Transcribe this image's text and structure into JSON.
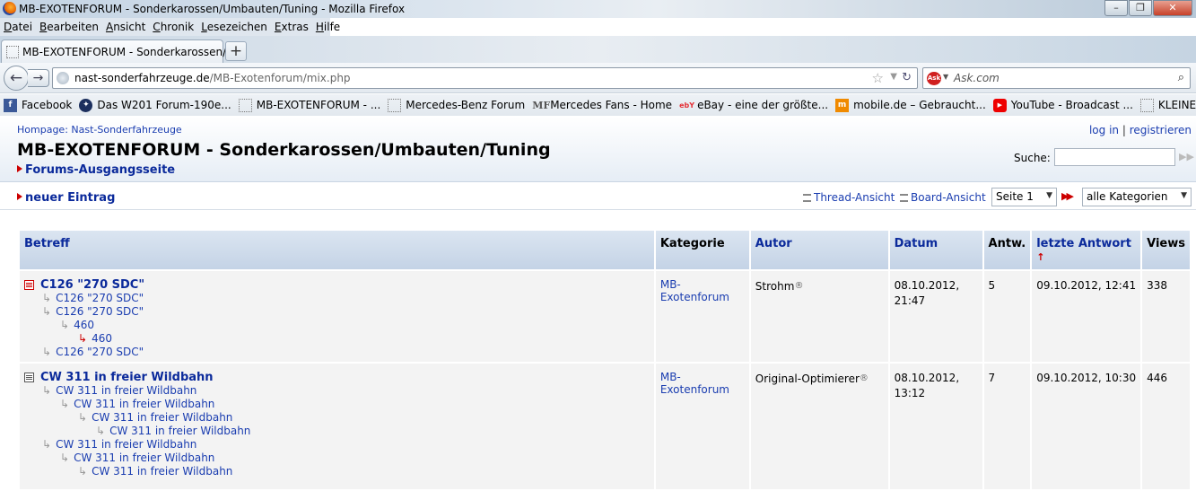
{
  "window": {
    "title": "MB-EXOTENFORUM - Sonderkarossen/Umbauten/Tuning - Mozilla Firefox",
    "buttons": [
      "–",
      "❐",
      "✕"
    ]
  },
  "menu": [
    "Datei",
    "Bearbeiten",
    "Ansicht",
    "Chronik",
    "Lesezeichen",
    "Extras",
    "Hilfe"
  ],
  "tab": {
    "title": "MB-EXOTENFORUM - Sonderkarossen/...",
    "new_tab": "+"
  },
  "url": {
    "domain": "nast-sonderfahrzeuge.de",
    "path": "/MB-Exotenforum/mix.php"
  },
  "search": {
    "placeholder": "Ask.com",
    "engine": "Ask"
  },
  "bookmarks": [
    {
      "label": "Facebook",
      "icon": "facebook-icon"
    },
    {
      "label": "Das W201 Forum-190e...",
      "icon": "mercedes-icon"
    },
    {
      "label": "MB-EXOTENFORUM - ...",
      "icon": "page-icon"
    },
    {
      "label": "Mercedes-Benz Forum",
      "icon": "page-icon"
    },
    {
      "label": "Mercedes Fans - Home",
      "icon": "mf-icon"
    },
    {
      "label": "eBay - eine der größte...",
      "icon": "ebay-icon"
    },
    {
      "label": "mobile.de – Gebraucht...",
      "icon": "mobile-icon"
    },
    {
      "label": "YouTube - Broadcast ...",
      "icon": "youtube-icon"
    },
    {
      "label": "KLEINENBROICH Wett...",
      "icon": "page-icon"
    }
  ],
  "header": {
    "homepage": "Hompage: Nast-Sonderfahrzeuge",
    "title": "MB-EXOTENFORUM - Sonderkarossen/Umbauten/Tuning",
    "exit_link": "Forums-Ausgangsseite",
    "login": "log in",
    "separator": "|",
    "register": "registrieren",
    "search_label": "Suche:"
  },
  "toolbar": {
    "new_entry": "neuer Eintrag",
    "thread_view": "Thread-Ansicht",
    "board_view": "Board-Ansicht",
    "page_select": "Seite 1",
    "category_select": "alle Kategorien"
  },
  "table": {
    "headers": {
      "subject": "Betreff",
      "category": "Kategorie",
      "author": "Autor",
      "date": "Datum",
      "replies": "Antw.",
      "last_reply": "letzte Antwort",
      "views": "Views"
    },
    "sort_indicator": "↑",
    "threads": [
      {
        "subject": "C126 \"270 SDC\"",
        "category": "MB-Exotenforum",
        "author": "Strohm",
        "date": "08.10.2012,",
        "time": "21:47",
        "replies": "5",
        "last_reply": "09.10.2012, 12:41",
        "views": "338",
        "children": [
          {
            "label": "C126 \"270 SDC\"",
            "level": 1
          },
          {
            "label": "C126 \"270 SDC\"",
            "level": 1
          },
          {
            "label": "460",
            "level": 2
          },
          {
            "label": "460",
            "level": 3,
            "new": true
          },
          {
            "label": "C126 \"270 SDC\"",
            "level": 1
          }
        ]
      },
      {
        "subject": "CW 311 in freier Wildbahn",
        "category": "MB-Exotenforum",
        "author": "Original-Optimierer",
        "date": "08.10.2012,",
        "time": "13:12",
        "replies": "7",
        "last_reply": "09.10.2012, 10:30",
        "views": "446",
        "children": [
          {
            "label": "CW 311 in freier Wildbahn",
            "level": 1
          },
          {
            "label": "CW 311 in freier Wildbahn",
            "level": 2
          },
          {
            "label": "CW 311 in freier Wildbahn",
            "level": 3
          },
          {
            "label": "CW 311 in freier Wildbahn",
            "level": 4
          },
          {
            "label": "CW 311 in freier Wildbahn",
            "level": 1
          },
          {
            "label": "CW 311 in freier Wildbahn",
            "level": 2
          },
          {
            "label": "CW 311 in freier Wildbahn",
            "level": 3
          }
        ]
      }
    ],
    "registered_mark": "®"
  }
}
